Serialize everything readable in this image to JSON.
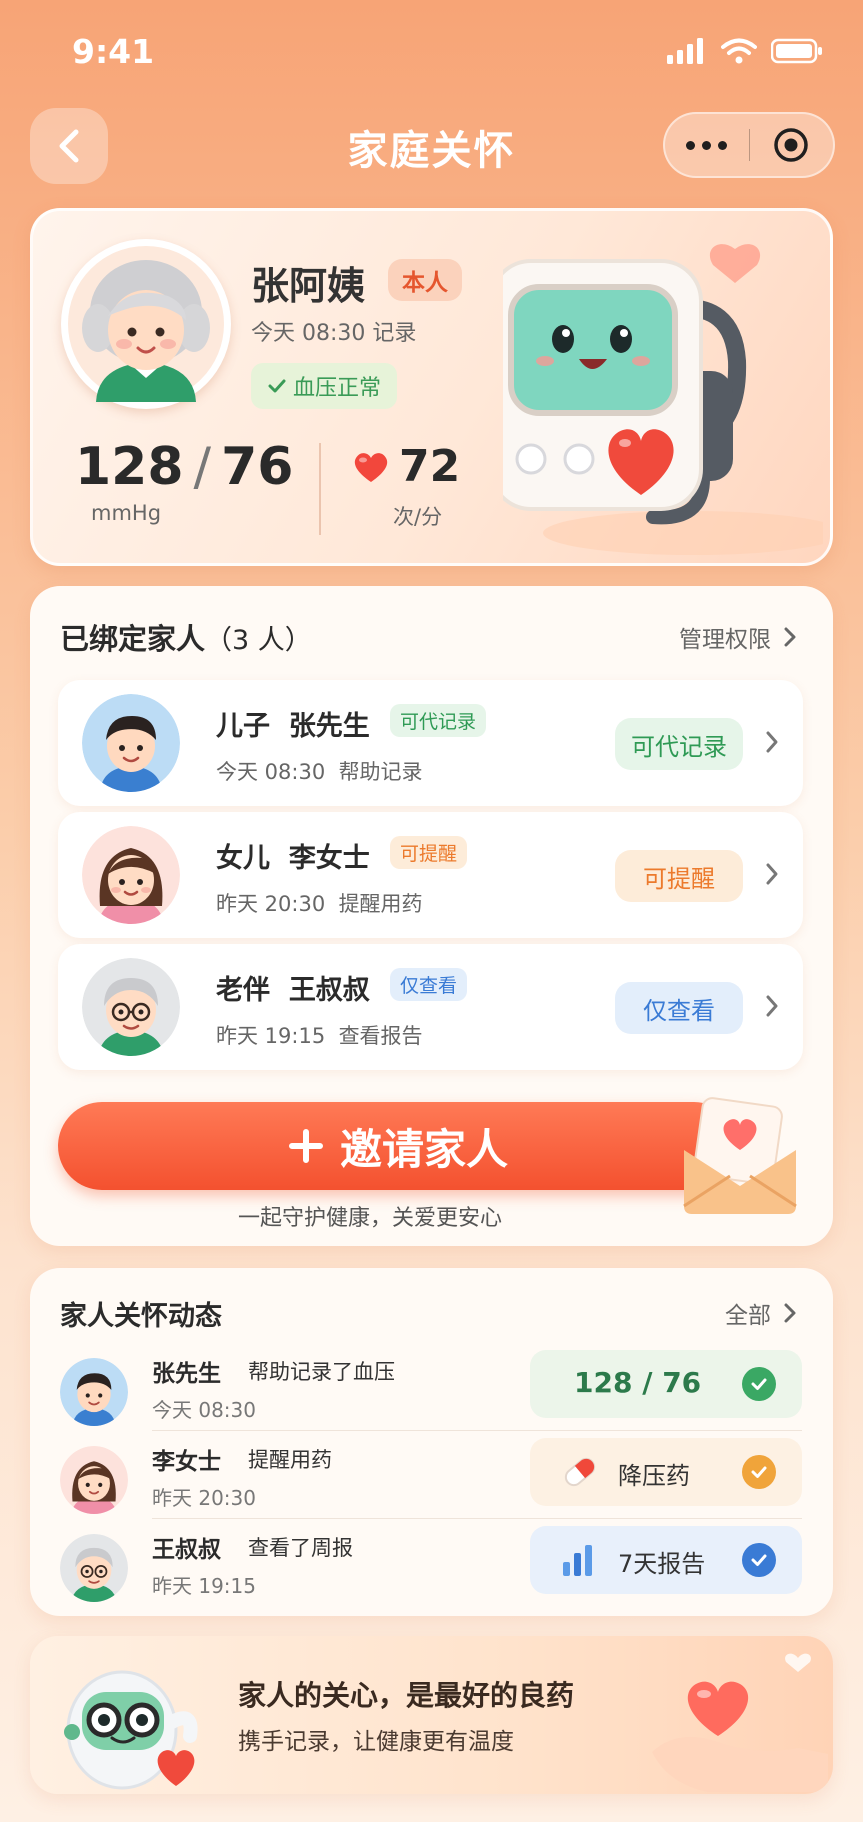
{
  "status_bar": {
    "time": "9:41"
  },
  "nav": {
    "title": "家庭关怀"
  },
  "profile": {
    "name": "张阿姨",
    "badge": "本人",
    "record_time": "今天 08:30 记录",
    "status": "血压正常",
    "systolic": "128",
    "diastolic": "76",
    "bp_unit": "mmHg",
    "heart_rate": "72",
    "hr_unit": "次/分"
  },
  "family": {
    "title": "已绑定家人",
    "count": "（3 人）",
    "manage_label": "管理权限",
    "members": [
      {
        "relation": "儿子",
        "name": "张先生",
        "tag": "可代记录",
        "time": "今天 08:30",
        "action": "帮助记录",
        "permission": "可代记录"
      },
      {
        "relation": "女儿",
        "name": "李女士",
        "tag": "可提醒",
        "time": "昨天 20:30",
        "action": "提醒用药",
        "permission": "可提醒"
      },
      {
        "relation": "老伴",
        "name": "王叔叔",
        "tag": "仅查看",
        "time": "昨天 19:15",
        "action": "查看报告",
        "permission": "仅查看"
      }
    ],
    "invite_label": "邀请家人",
    "invite_sub": "一起守护健康，关爱更安心"
  },
  "activity": {
    "title": "家人关怀动态",
    "all_label": "全部",
    "items": [
      {
        "name": "张先生",
        "action": "帮助记录了血压",
        "time": "今天 08:30",
        "pill_systolic": "128",
        "pill_diastolic": "76",
        "color": "#3aa864"
      },
      {
        "name": "李女士",
        "action": "提醒用药",
        "time": "昨天 20:30",
        "pill_text": "降压药",
        "icon": "pill-icon",
        "color": "#f0a43a"
      },
      {
        "name": "王叔叔",
        "action": "查看了周报",
        "time": "昨天 19:15",
        "pill_text": "7天报告",
        "icon": "bar-chart-icon",
        "color": "#3a7bd5"
      }
    ]
  },
  "banner": {
    "title": "家人的关心，是最好的良药",
    "subtitle": "携手记录，让健康更有温度"
  },
  "colors": {
    "accent": "#f4512f",
    "green": "#3aa864",
    "orange": "#f0a43a",
    "blue": "#3a7bd5"
  }
}
